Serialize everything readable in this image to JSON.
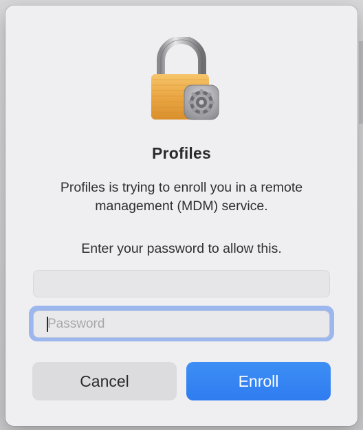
{
  "dialog": {
    "title": "Profiles",
    "message": "Profiles is trying to enroll you in a remote management (MDM) service.",
    "prompt": "Enter your password to allow this.",
    "icon": "lock-with-gear-icon"
  },
  "fields": {
    "username": {
      "value": "",
      "placeholder": ""
    },
    "password": {
      "value": "",
      "placeholder": "Password"
    }
  },
  "buttons": {
    "cancel_label": "Cancel",
    "enroll_label": "Enroll"
  },
  "colors": {
    "accent": "#2f7cf0",
    "focus_ring": "#9bb7ee",
    "dialog_bg": "#efeef0"
  }
}
